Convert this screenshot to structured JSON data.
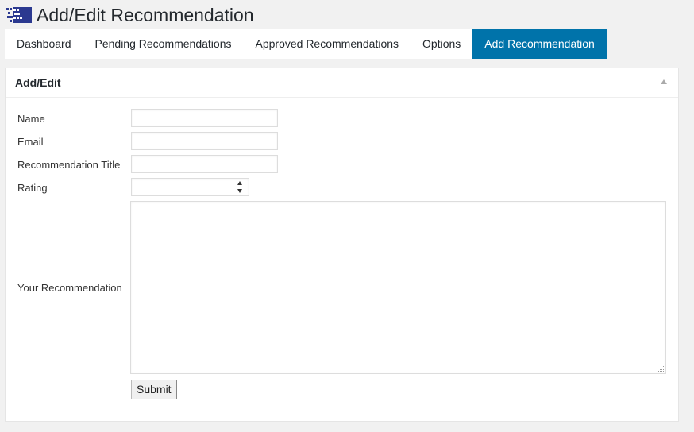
{
  "header": {
    "title": "Add/Edit Recommendation",
    "logo_icon": "plugin-logo-icon"
  },
  "tabs": [
    {
      "label": "Dashboard",
      "active": false
    },
    {
      "label": "Pending Recommendations",
      "active": false
    },
    {
      "label": "Approved Recommendations",
      "active": false
    },
    {
      "label": "Options",
      "active": false
    },
    {
      "label": "Add Recommendation",
      "active": true
    }
  ],
  "panel": {
    "title": "Add/Edit",
    "collapse_icon": "triangle-up-icon"
  },
  "form": {
    "name_label": "Name",
    "name_value": "",
    "email_label": "Email",
    "email_value": "",
    "title_label": "Recommendation Title",
    "title_value": "",
    "rating_label": "Rating",
    "rating_value": "",
    "recommendation_label": "Your Recommendation",
    "recommendation_value": "",
    "submit_label": "Submit"
  },
  "colors": {
    "active_tab": "#0073aa",
    "background": "#f1f1f1",
    "logo": "#2b3990"
  }
}
